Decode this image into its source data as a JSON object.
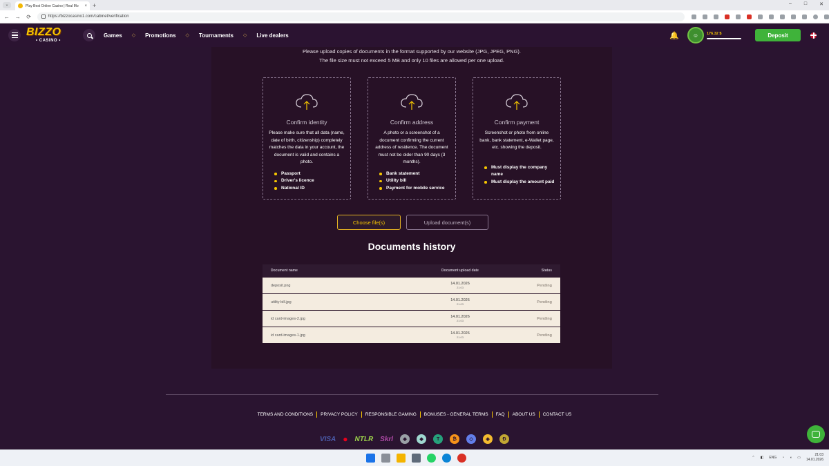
{
  "browser": {
    "tab_title": "Play Best Online Casino | Real Mo",
    "tab_close": "×",
    "new_tab": "+",
    "tab_menu": "⌄",
    "url": "https://bizzocasino1.com/cabinet/verification",
    "back": "←",
    "forward": "→",
    "reload": "⟳",
    "minimize": "–",
    "maximize": "□",
    "close": "✕"
  },
  "header": {
    "logo_main": "BIZZO",
    "logo_sub": "• CASINO •",
    "nav": [
      "Games",
      "Promotions",
      "Tournaments",
      "Live dealers"
    ],
    "nav_separator": "◇",
    "balance": "176.32 $",
    "deposit_label": "Deposit"
  },
  "verification": {
    "intro_line1": "Please upload copies of documents in the format supported by our website (JPG, JPEG, PNG).",
    "intro_line2": "The file size must not exceed 5 MB and only 10 files are allowed per one upload.",
    "cards": [
      {
        "title": "Confirm identity",
        "description": "Please make sure that all data (name, date of birth, citizenship) completely matches the data in your account, the document is valid and contains a photo.",
        "items": [
          "Passport",
          "Driver's licence",
          "National ID"
        ]
      },
      {
        "title": "Confirm address",
        "description": "A photo or a screenshot of a document confirming the current address of residence. The document must not be older than 90 days (3 months).",
        "items": [
          "Bank statement",
          "Utility bill",
          "Payment for mobile service"
        ]
      },
      {
        "title": "Confirm payment",
        "description": "Screenshot or photo from online bank, bank statement, e-Wallet page, etc. showing the deposit.",
        "items": [
          "Must display the company name",
          "Must display the amount paid"
        ]
      }
    ],
    "choose_label": "Choose file(s)",
    "upload_label": "Upload document(s)"
  },
  "history": {
    "title": "Documents history",
    "columns": [
      "Document name",
      "Document upload date",
      "Status"
    ],
    "rows": [
      {
        "name": "deposit.png",
        "date": "14.01.2026",
        "time": "21:03",
        "status": "Pending"
      },
      {
        "name": "utility bill.jpg",
        "date": "14.01.2026",
        "time": "21:03",
        "status": "Pending"
      },
      {
        "name": "id card-images-2.jpg",
        "date": "14.01.2026",
        "time": "21:03",
        "status": "Pending"
      },
      {
        "name": "id card-images-1.jpg",
        "date": "14.01.2026",
        "time": "21:03",
        "status": "Pending"
      }
    ]
  },
  "footer": {
    "links": [
      "TERMS AND CONDITIONS",
      "PRIVACY POLICY",
      "RESPONSIBLE GAMING",
      "BONUSES - GENERAL TERMS",
      "FAQ",
      "ABOUT US",
      "CONTACT US"
    ],
    "payments": [
      "VISA",
      "NTLR",
      "Skrl"
    ]
  },
  "taskbar": {
    "lang": "ENG",
    "time": "21:03",
    "date": "14.01.2026"
  },
  "colors": {
    "accent_gold": "#f6c600",
    "deposit_green": "#3fb33a",
    "background": "#2a1430"
  }
}
